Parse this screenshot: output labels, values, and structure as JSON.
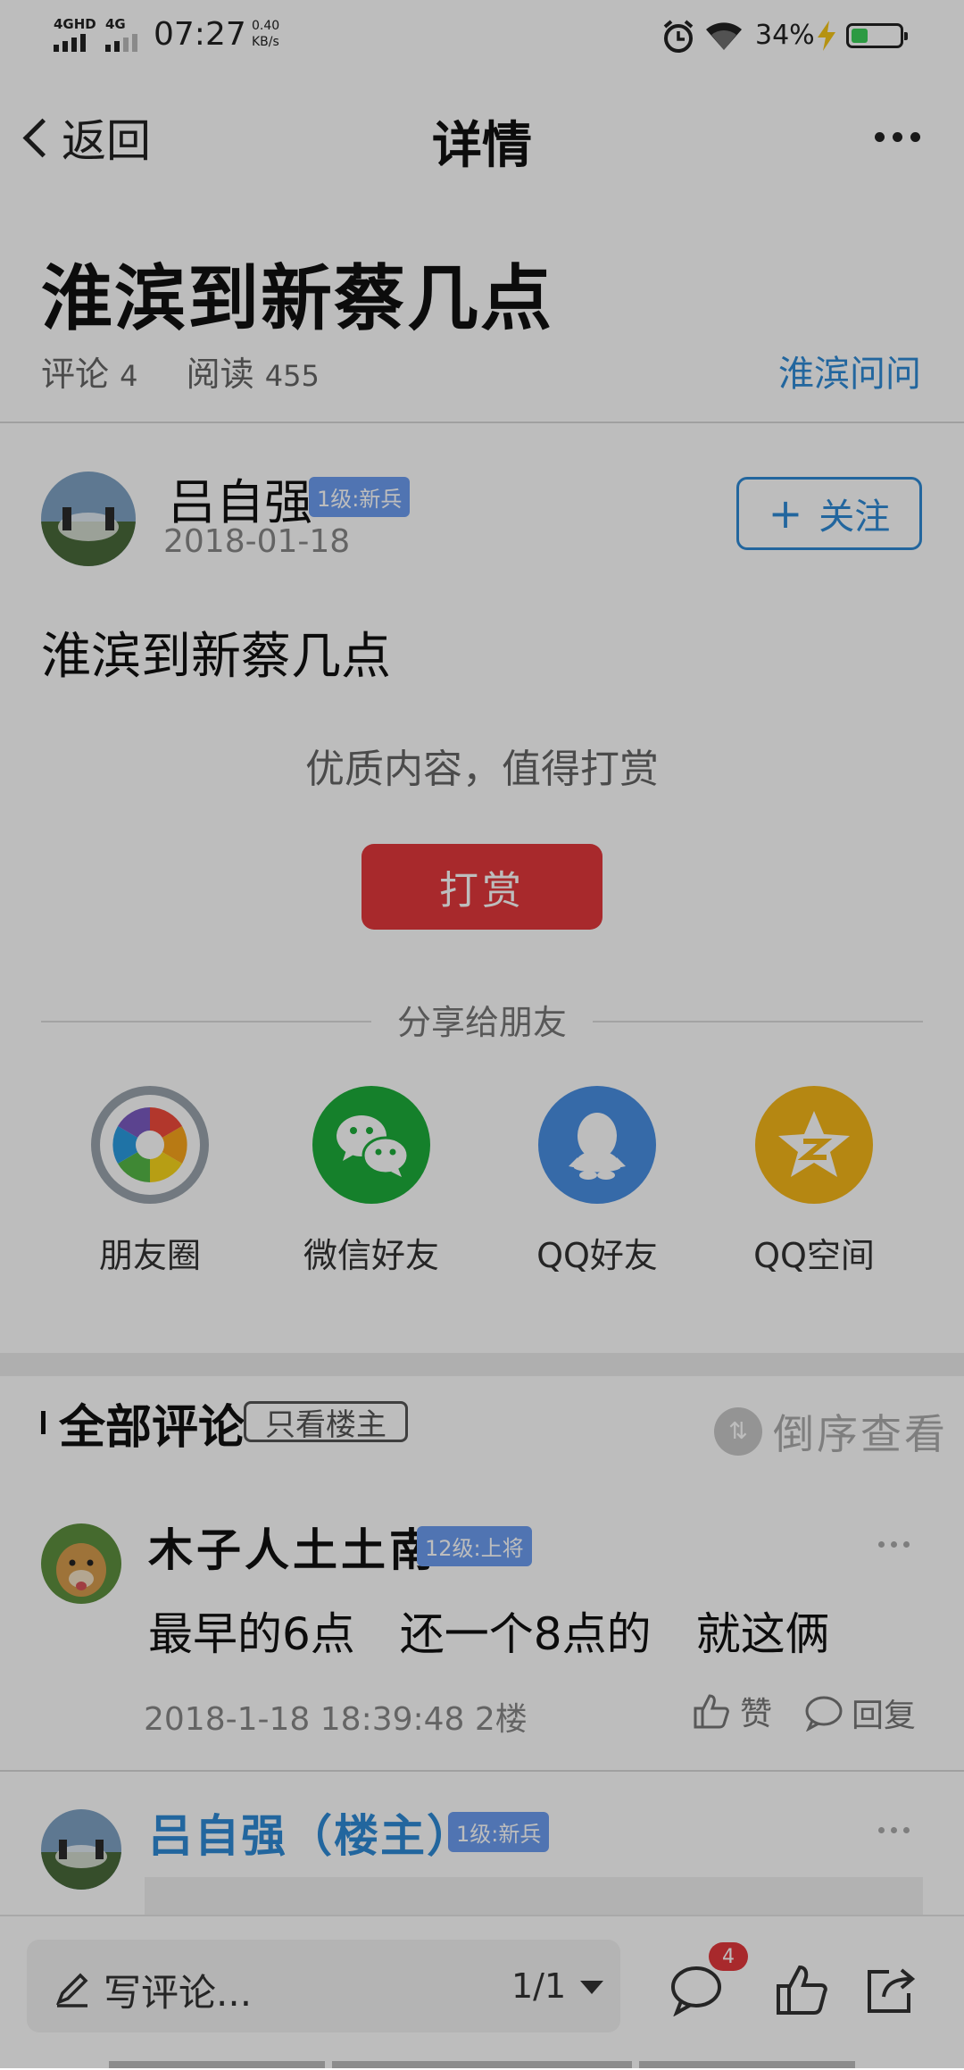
{
  "status_bar": {
    "sim1": "4GHD",
    "sim2": "4G",
    "time": "07:27",
    "net_speed_value": "0.40",
    "net_speed_unit": "KB/s",
    "battery_pct_label": "34%",
    "battery_level": 0.34,
    "icons": [
      "alarm-icon",
      "wifi-icon",
      "charging-bolt-icon",
      "battery-icon"
    ]
  },
  "header": {
    "back_label": "返回",
    "title": "详情"
  },
  "post": {
    "title": "淮滨到新蔡几点",
    "comments_label": "评论",
    "comments_count": "4",
    "reads_label": "阅读",
    "reads_count": "455",
    "forum_link": "淮滨问问"
  },
  "author": {
    "name": "吕自强",
    "level_badge": "1级:新兵",
    "date": "2018-01-18",
    "follow_label": "关注"
  },
  "body": {
    "text": "淮滨到新蔡几点"
  },
  "reward": {
    "prompt": "优质内容，值得打赏",
    "button_label": "打赏"
  },
  "share": {
    "title": "分享给朋友",
    "targets": [
      {
        "label": "朋友圈",
        "icon": "moments-icon",
        "color": "#9aa4ad"
      },
      {
        "label": "微信好友",
        "icon": "wechat-icon",
        "color": "#1dad3a"
      },
      {
        "label": "QQ好友",
        "icon": "qq-icon",
        "color": "#4a8fe3"
      },
      {
        "label": "QQ空间",
        "icon": "qzone-icon",
        "color": "#f5b619"
      }
    ]
  },
  "comments_section": {
    "title": "全部评论",
    "op_only_label": "只看楼主",
    "sort_label": "倒序查看"
  },
  "comments": [
    {
      "name": "木子人土土南",
      "level_badge": "12级:上将",
      "text": "最早的6点　还一个8点的　就这俩",
      "meta": "2018-1-18 18:39:48 2楼",
      "like_label": "赞",
      "reply_label": "回复"
    },
    {
      "name": "吕自强（楼主）",
      "level_badge": "1级:新兵"
    }
  ],
  "bottom_bar": {
    "write_label": "写评论...",
    "page_indicator": "1/1",
    "comment_count_badge": "4"
  },
  "colors": {
    "accent_blue": "#2f8ad6",
    "reward_red": "#e3383c",
    "badge_blue": "#6c9df0"
  }
}
